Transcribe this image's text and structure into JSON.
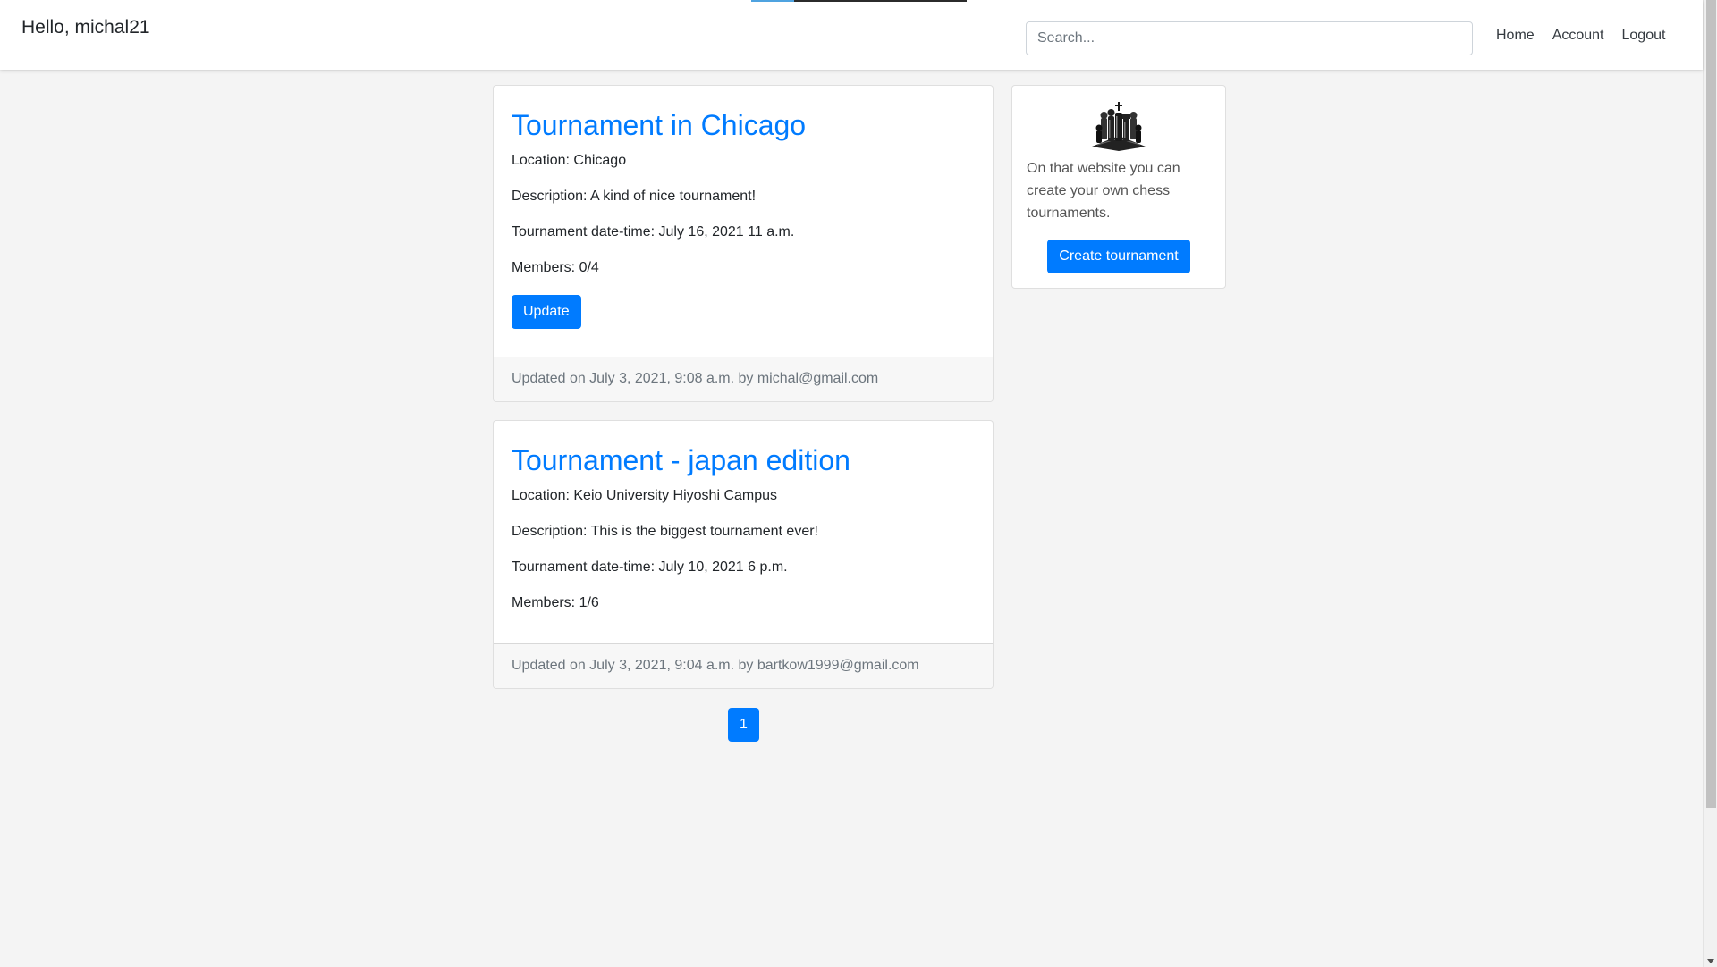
{
  "navbar": {
    "greeting": "Hello, michal21",
    "search_placeholder": "Search...",
    "links": [
      "Home",
      "Account",
      "Logout"
    ]
  },
  "posts": [
    {
      "title": "Tournament in Chicago",
      "location": "Location: Chicago",
      "description": "Description: A kind of nice tournament!",
      "datetime": "Tournament date-time: July 16, 2021 11 a.m.",
      "members": "Members: 0/4",
      "update_label": "Update",
      "footer": "Updated on July 3, 2021, 9:08 a.m. by michal@gmail.com"
    },
    {
      "title": "Tournament - japan edition",
      "location": "Location: Keio University Hiyoshi Campus",
      "description": "Description: This is the biggest tournament ever!",
      "datetime": "Tournament date-time: July 10, 2021 6 p.m.",
      "members": "Members: 1/6",
      "footer": "Updated on July 3, 2021, 9:04 a.m. by bartkow1999@gmail.com"
    }
  ],
  "pagination": {
    "current_page": "1"
  },
  "sidebar": {
    "icon": "chess-pieces-icon",
    "text": "On that website you can create your own chess tournaments.",
    "create_label": "Create tournament"
  },
  "colors": {
    "primary": "#007bff",
    "background": "#f4f4f4"
  }
}
